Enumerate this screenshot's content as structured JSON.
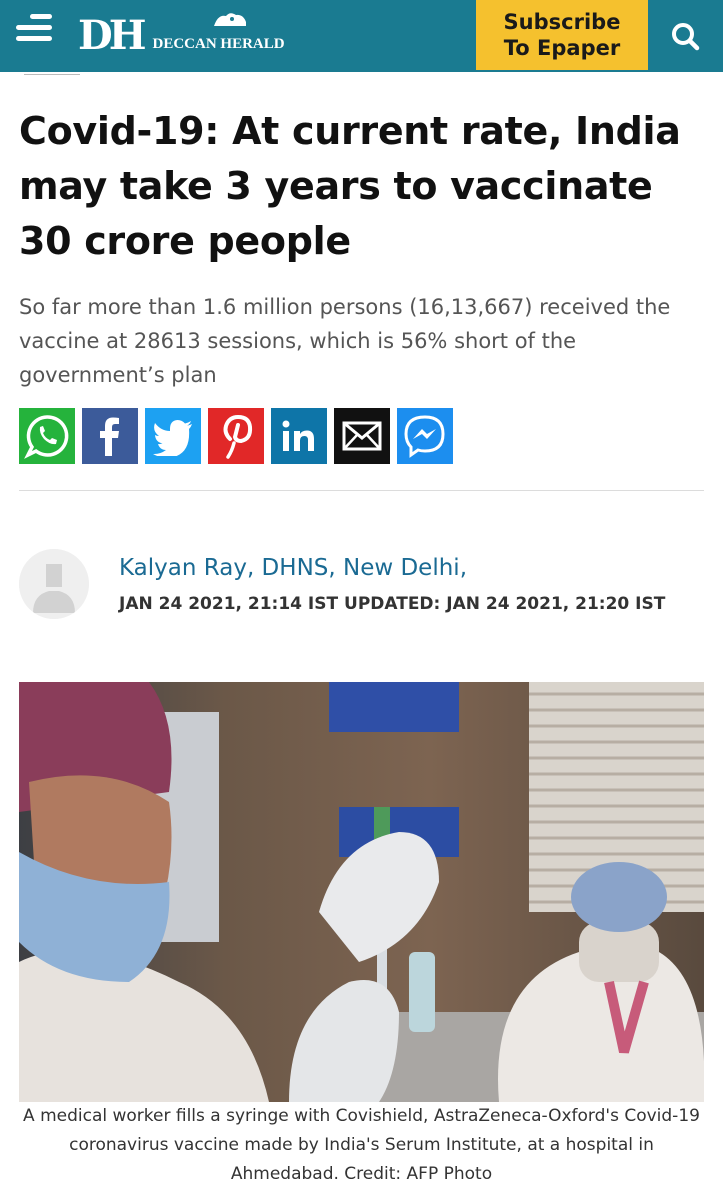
{
  "header": {
    "brand_short": "DH",
    "brand_name": "DECCAN HERALD",
    "subscribe_line1": "Subscribe",
    "subscribe_line2": "To Epaper",
    "colors": {
      "bar": "#1a7b91",
      "subscribe": "#f5c12e"
    },
    "icons": [
      "menu-icon",
      "search-icon"
    ]
  },
  "article": {
    "headline": "Covid-19: At current rate, India may take 3 years to vaccinate 30 crore people",
    "summary": "So far more than 1.6 million persons (16,13,667) received the vaccine at 28613 sessions, which is 56% short of the government’s plan",
    "share": [
      {
        "network": "whatsapp",
        "icon": "whatsapp-icon",
        "color": "#25b33c"
      },
      {
        "network": "facebook",
        "icon": "facebook-icon",
        "color": "#3c5b9a"
      },
      {
        "network": "twitter",
        "icon": "twitter-icon",
        "color": "#1da1f2"
      },
      {
        "network": "pinterest",
        "icon": "pinterest-icon",
        "color": "#e12828"
      },
      {
        "network": "linkedin",
        "icon": "linkedin-icon",
        "color": "#0e75a8"
      },
      {
        "network": "email",
        "icon": "email-icon",
        "color": "#111111"
      },
      {
        "network": "messenger",
        "icon": "messenger-icon",
        "color": "#1c8eef"
      }
    ],
    "author": "Kalyan Ray, DHNS, New Delhi,",
    "dates": "JAN 24 2021, 21:14 IST UPDATED: JAN 24 2021, 21:20 IST",
    "caption": "A medical worker fills a syringe with Covishield, AstraZeneca-Oxford's Covid-19 coronavirus vaccine made by India's Serum Institute, at a hospital in Ahmedabad. Credit: AFP Photo"
  }
}
